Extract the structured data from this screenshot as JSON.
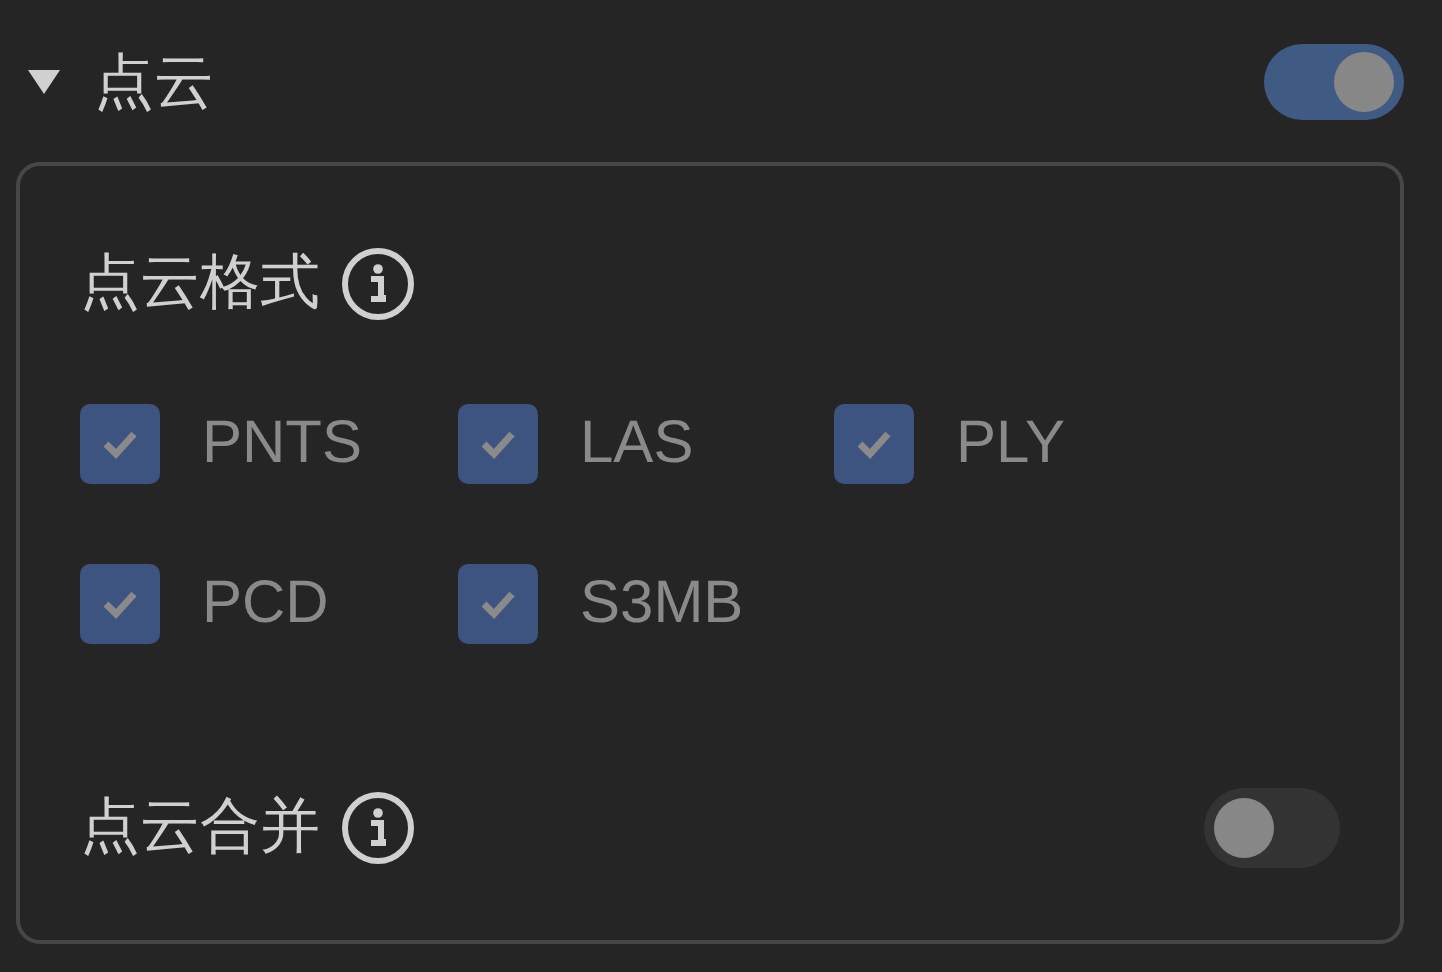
{
  "section": {
    "title": "点云",
    "expanded": true,
    "on": true
  },
  "formats": {
    "label": "点云格式",
    "options": [
      {
        "label": "PNTS",
        "checked": true
      },
      {
        "label": "LAS",
        "checked": true
      },
      {
        "label": "PLY",
        "checked": true
      },
      {
        "label": "PCD",
        "checked": true
      },
      {
        "label": "S3MB",
        "checked": true
      }
    ]
  },
  "merge": {
    "label": "点云合并",
    "on": false
  }
}
